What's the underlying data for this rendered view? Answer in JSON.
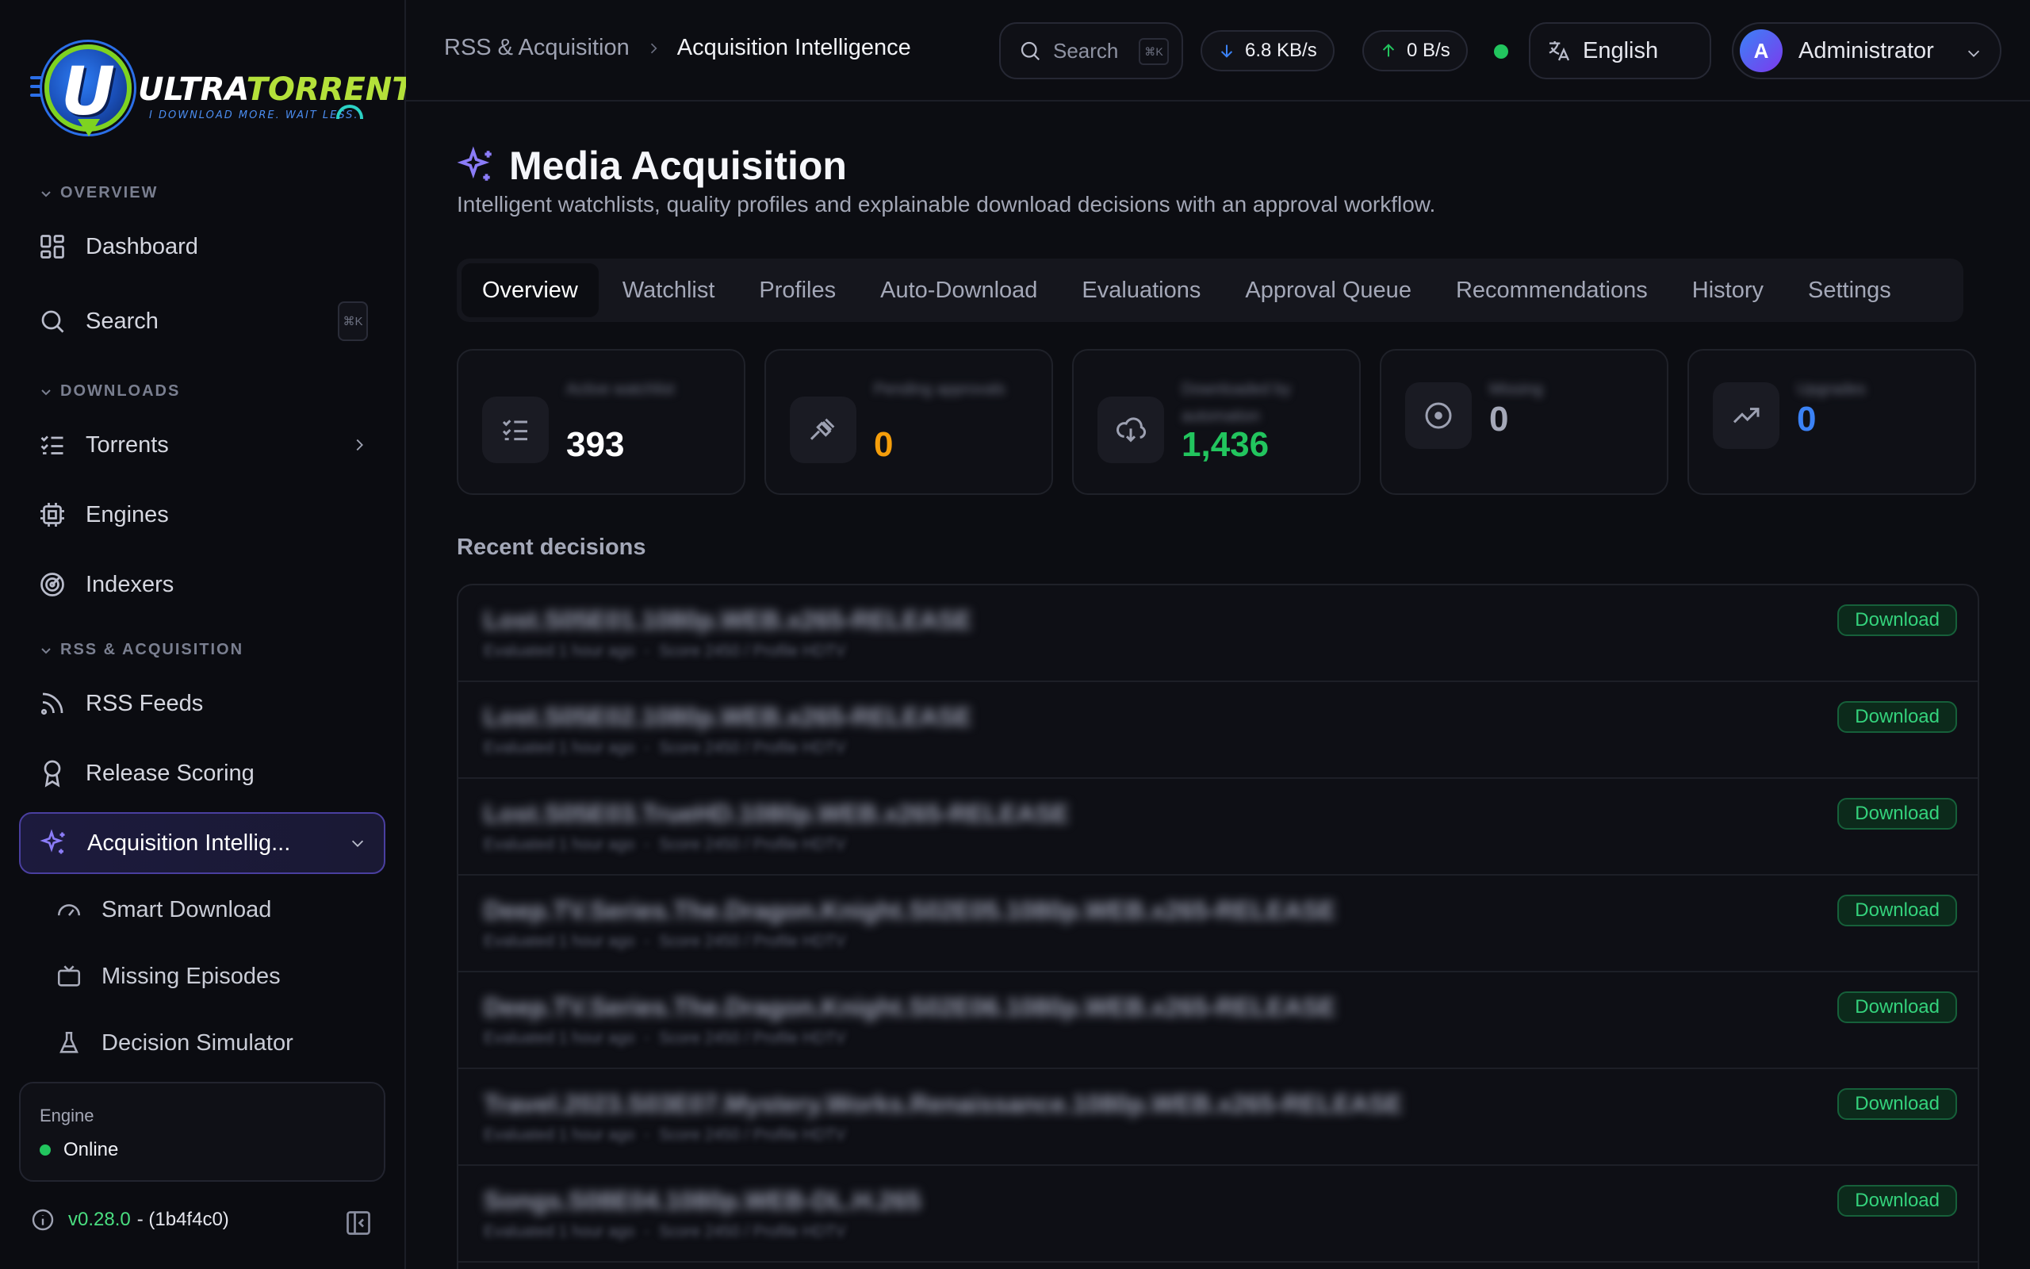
{
  "app": {
    "logo_main": "ULTRA",
    "logo_accent": "TORRENT",
    "logo_tagline": "I DOWNLOAD MORE. WAIT LESS.",
    "logo_letter": "U"
  },
  "sidebar": {
    "sections": {
      "overview": "OVERVIEW",
      "downloads": "DOWNLOADS",
      "rss": "RSS & ACQUISITION"
    },
    "items": {
      "dashboard": "Dashboard",
      "search": "Search",
      "search_shortcut": "⌘K",
      "torrents": "Torrents",
      "engines": "Engines",
      "indexers": "Indexers",
      "rss_feeds": "RSS Feeds",
      "release_scoring": "Release Scoring",
      "acquisition": "Acquisition Intellig..."
    },
    "subitems": {
      "smart_download": "Smart Download",
      "missing_episodes": "Missing Episodes",
      "decision_simulator": "Decision Simulator"
    },
    "engine": {
      "label": "Engine",
      "status": "Online",
      "status_color": "#22c55e"
    },
    "version": "v0.28.0",
    "build": "- (1b4f4c0)"
  },
  "topbar": {
    "breadcrumb": [
      "RSS & Acquisition",
      "Acquisition Intelligence"
    ],
    "search_placeholder": "Search",
    "search_shortcut": "⌘K",
    "download_rate": "6.8 KB/s",
    "upload_rate": "0 B/s",
    "language": "English",
    "user_name": "Administrator",
    "user_initial": "A"
  },
  "page": {
    "title": "Media Acquisition",
    "subtitle": "Intelligent watchlists, quality profiles and explainable download decisions with an approval workflow.",
    "tabs": [
      "Overview",
      "Watchlist",
      "Profiles",
      "Auto-Download",
      "Evaluations",
      "Approval Queue",
      "Recommendations",
      "History",
      "Settings"
    ],
    "active_tab": "Overview",
    "stats": [
      {
        "label": "Active watchlist",
        "value": "393",
        "color": "#ffffff",
        "icon": "checklist-icon"
      },
      {
        "label": "Pending approvals",
        "value": "0",
        "color": "#f59e0b",
        "icon": "gavel-icon"
      },
      {
        "label": "Downloaded by automation",
        "value": "1,436",
        "color": "#22c55e",
        "icon": "cloud-download-icon"
      },
      {
        "label": "Missing",
        "value": "0",
        "color": "#a4a8b8",
        "icon": "target-icon"
      },
      {
        "label": "Upgrades",
        "value": "0",
        "color": "#3b82f6",
        "icon": "trending-up-icon"
      }
    ],
    "recent_label": "Recent decisions",
    "decisions": [
      {
        "name": "Lost.S05E01.1080p.WEB.x265-RELEASE",
        "meta_left": "Evaluated 1 hour ago",
        "meta_right": "Score 2450 / Profile HDTV",
        "decision": "Download"
      },
      {
        "name": "Lost.S05E02.1080p.WEB.x265-RELEASE",
        "meta_left": "Evaluated 1 hour ago",
        "meta_right": "Score 2450 / Profile HDTV",
        "decision": "Download"
      },
      {
        "name": "Lost.S05E03.TrueHD.1080p.WEB.x265-RELEASE",
        "meta_left": "Evaluated 1 hour ago",
        "meta_right": "Score 2450 / Profile HDTV",
        "decision": "Download"
      },
      {
        "name": "Deep.TV.Series.The.Dragon.Knight.S02E05.1080p.WEB.x265-RELEASE",
        "meta_left": "Evaluated 1 hour ago",
        "meta_right": "Score 2450 / Profile HDTV",
        "decision": "Download"
      },
      {
        "name": "Deep.TV.Series.The.Dragon.Knight.S02E06.1080p.WEB.x265-RELEASE",
        "meta_left": "Evaluated 1 hour ago",
        "meta_right": "Score 2450 / Profile HDTV",
        "decision": "Download"
      },
      {
        "name": "Travel.2023.S03E07.Mystery.Works.Renaissance.1080p.WEB.x265-RELEASE",
        "meta_left": "Evaluated 1 hour ago",
        "meta_right": "Score 2450 / Profile HDTV",
        "decision": "Download"
      },
      {
        "name": "Songs.S08E04.1080p.WEB-DL.H.265",
        "meta_left": "Evaluated 1 hour ago",
        "meta_right": "Score 2450 / Profile HDTV",
        "decision": "Download"
      }
    ]
  }
}
